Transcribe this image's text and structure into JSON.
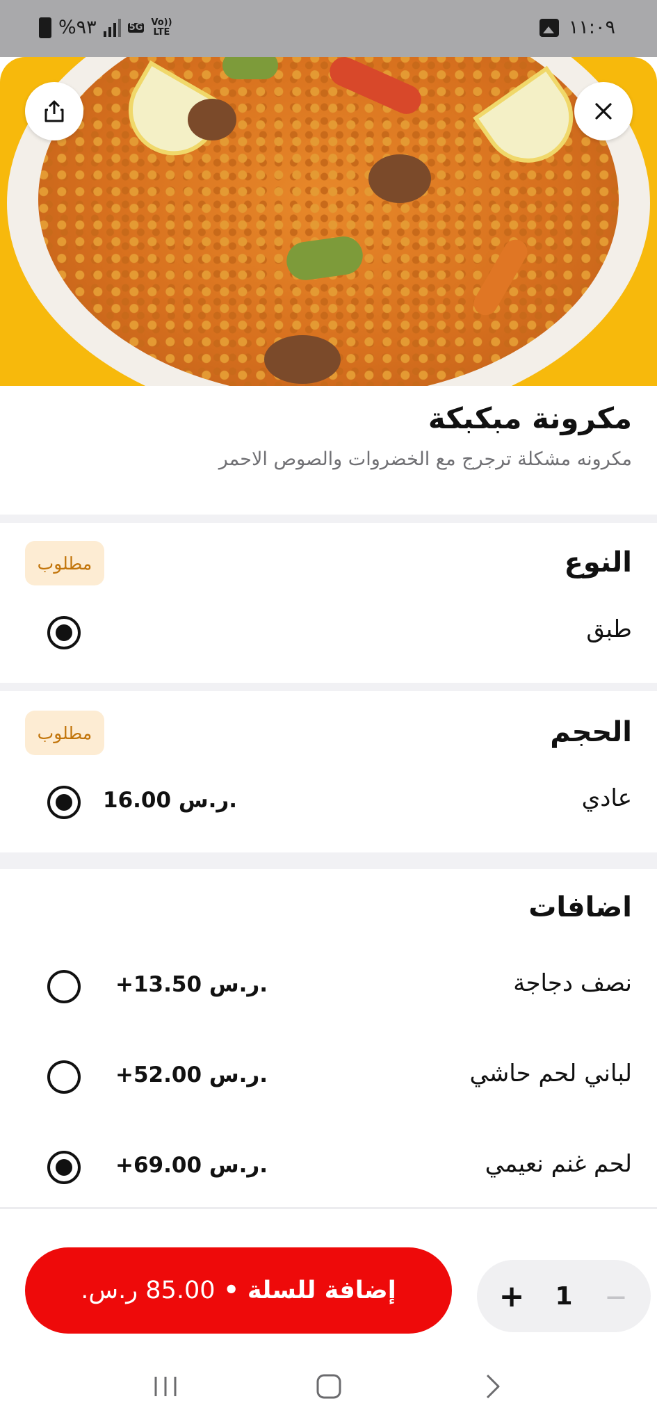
{
  "status_bar": {
    "time": "١١:٠٩",
    "battery": "%٩٣",
    "network_top": "5G",
    "volte": "Vo))",
    "lte": "LTE"
  },
  "product": {
    "title": "مكرونة مبكبكة",
    "description": "مكرونه مشكلة ترجرج مع الخضروات والصوص   الاحمر"
  },
  "sections": {
    "type": {
      "title": "النوع",
      "badge": "مطلوب",
      "options": [
        {
          "label": "طبق",
          "price": "",
          "selected": true
        }
      ]
    },
    "size": {
      "title": "الحجم",
      "badge": "مطلوب",
      "options": [
        {
          "label": "عادي",
          "price": "16.00 ر.س.",
          "selected": true
        }
      ]
    },
    "addons": {
      "title": "اضافات",
      "options": [
        {
          "label": "نصف دجاجة",
          "price": "+13.50 ر.س.",
          "selected": false
        },
        {
          "label": "لباني لحم حاشي",
          "price": "+52.00 ر.س.",
          "selected": false
        },
        {
          "label": "لحم غنم نعيمي",
          "price": "+69.00 ر.س.",
          "selected": true
        }
      ]
    }
  },
  "cart": {
    "add_label": "إضافة للسلة",
    "separator": "•",
    "total": "85.00 ر.س.",
    "quantity": "1",
    "minus": "—",
    "plus": "+"
  },
  "colors": {
    "accent_red": "#ee0a0a",
    "hero_yellow": "#f7b90c",
    "badge_bg": "#fdecd3",
    "badge_text": "#c2750b"
  },
  "icons": {
    "close": "close-icon",
    "share": "share-icon",
    "recents": "recents-icon",
    "home": "home-icon",
    "back": "back-icon"
  }
}
